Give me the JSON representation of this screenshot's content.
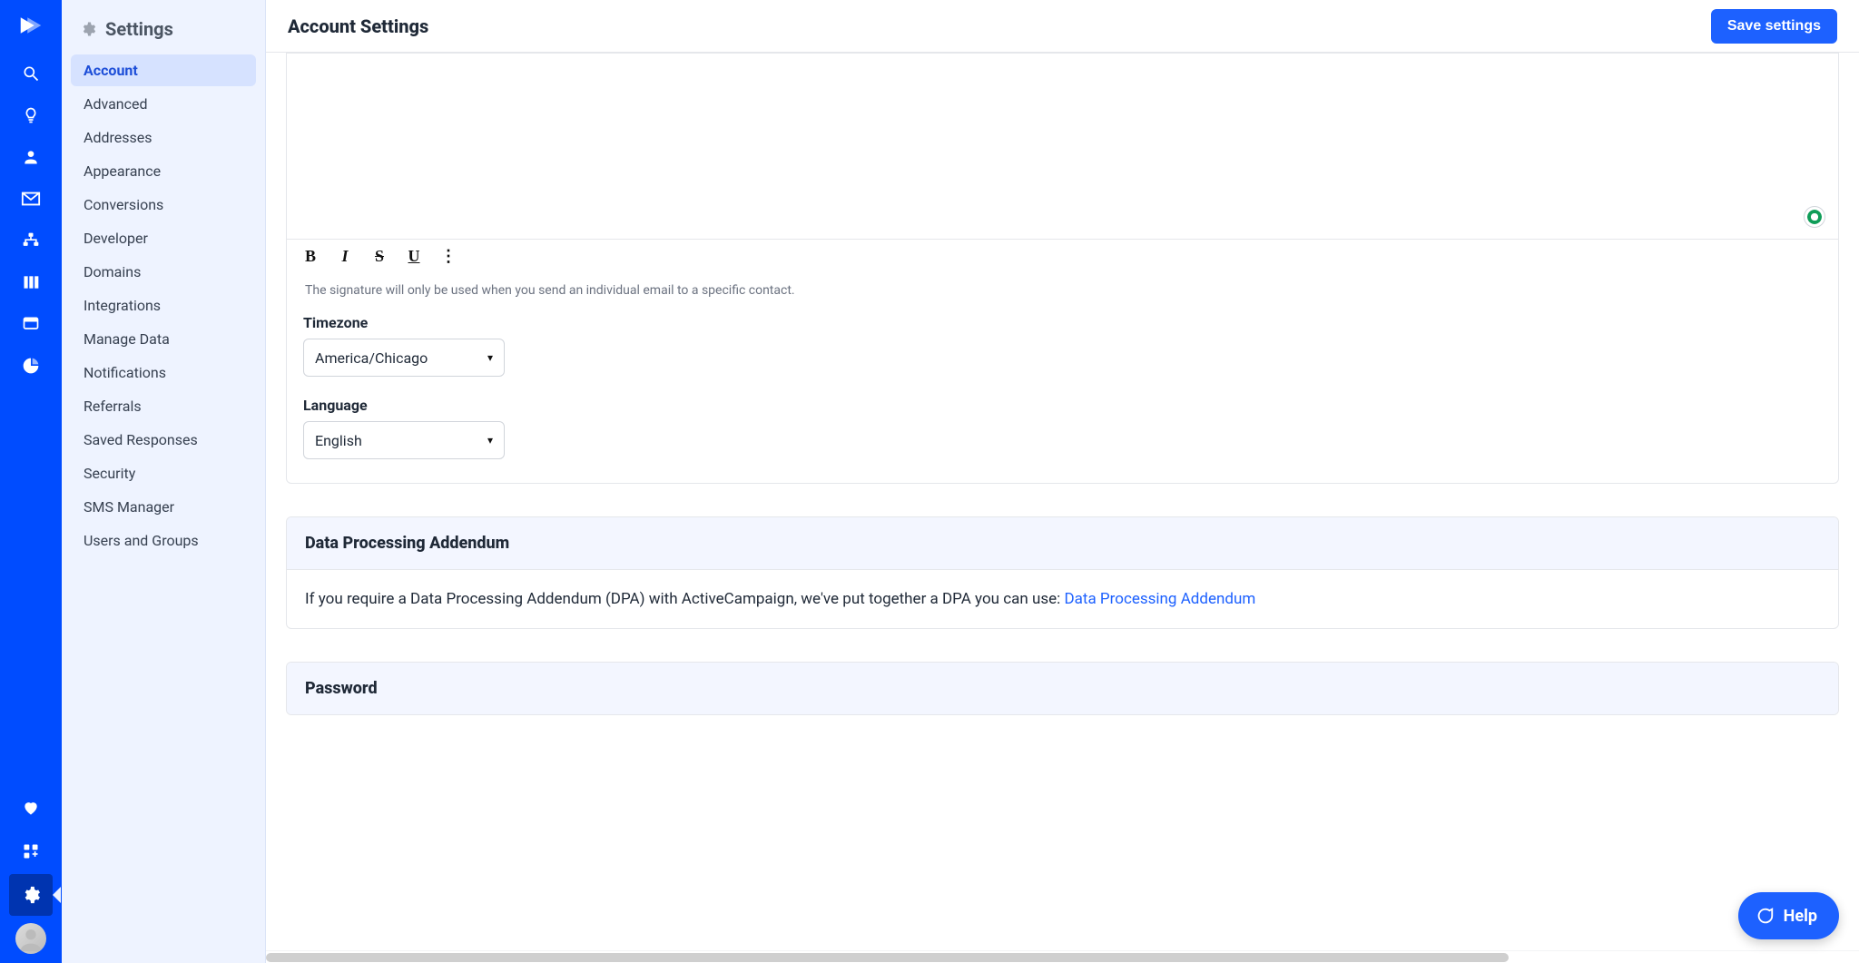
{
  "sidebar": {
    "title": "Settings",
    "items": [
      "Account",
      "Advanced",
      "Addresses",
      "Appearance",
      "Conversions",
      "Developer",
      "Domains",
      "Integrations",
      "Manage Data",
      "Notifications",
      "Referrals",
      "Saved Responses",
      "Security",
      "SMS Manager",
      "Users and Groups"
    ],
    "active_index": 0
  },
  "header": {
    "title": "Account Settings",
    "save_button": "Save settings"
  },
  "signature": {
    "helper": "The signature will only be used when you send an individual email to a specific contact."
  },
  "timezone": {
    "label": "Timezone",
    "value": "America/Chicago"
  },
  "language": {
    "label": "Language",
    "value": "English"
  },
  "dpa": {
    "title": "Data Processing Addendum",
    "text": "If you require a Data Processing Addendum (DPA) with ActiveCampaign, we've put together a DPA you can use: ",
    "link_text": "Data Processing Addendum"
  },
  "password": {
    "title": "Password"
  },
  "help": {
    "label": "Help"
  },
  "grammarly": {
    "letter": "G"
  }
}
